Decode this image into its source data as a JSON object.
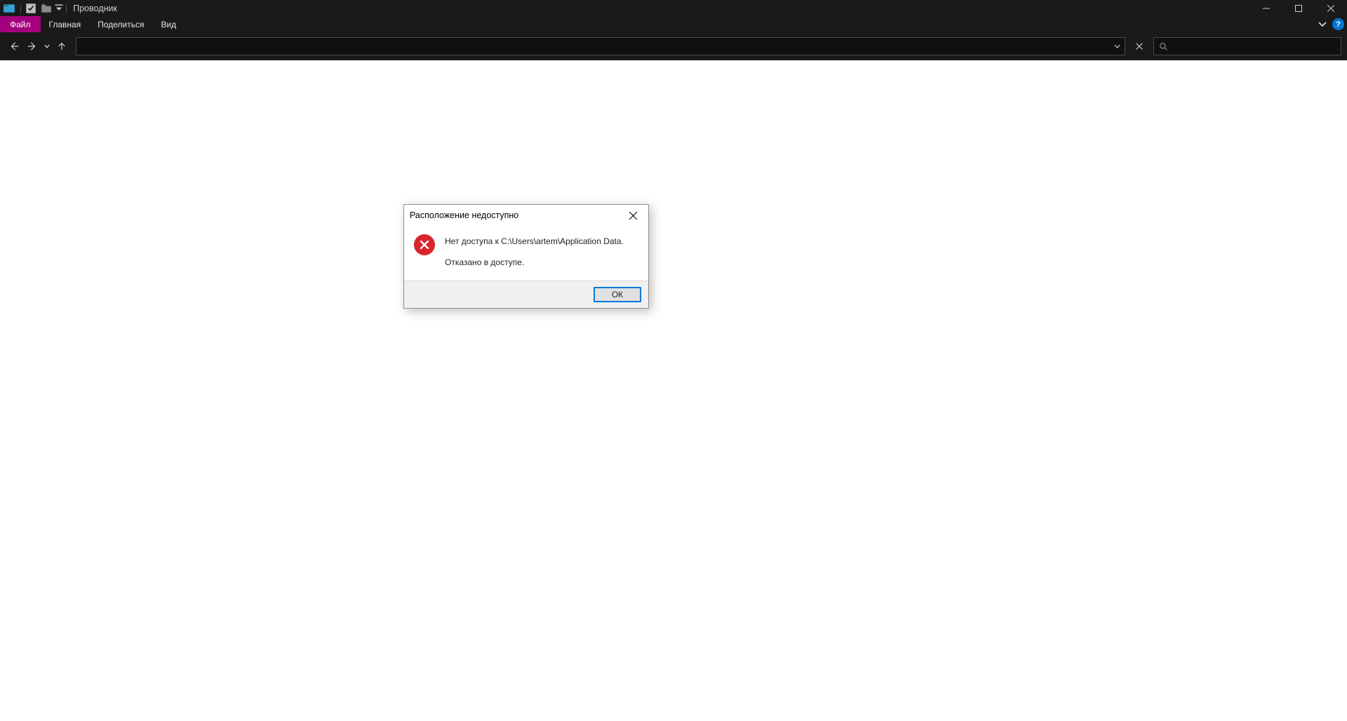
{
  "titlebar": {
    "app_title": "Проводник"
  },
  "ribbon": {
    "file": "Файл",
    "home": "Главная",
    "share": "Поделиться",
    "view": "Вид",
    "help_symbol": "?"
  },
  "nav": {
    "address_value": "",
    "search_placeholder": ""
  },
  "dialog": {
    "title": "Расположение недоступно",
    "line1": "Нет доступа к C:\\Users\\artem\\Application Data.",
    "line2": "Отказано в доступе.",
    "ok": "ОК"
  }
}
